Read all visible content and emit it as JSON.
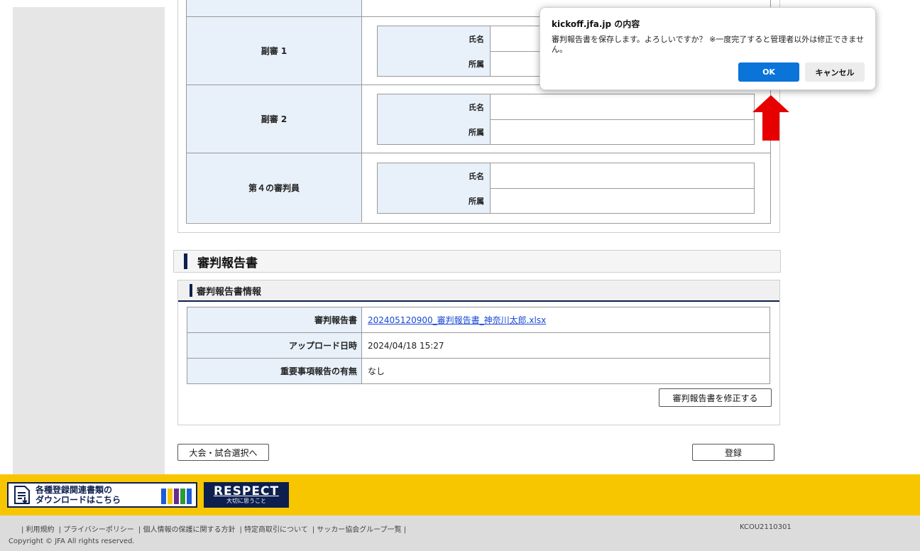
{
  "referees": [
    {
      "role": "副審 1",
      "name_label": "氏名",
      "org_label": "所属",
      "name": "",
      "org": ""
    },
    {
      "role": "副審 2",
      "name_label": "氏名",
      "org_label": "所属",
      "name": "",
      "org": ""
    },
    {
      "role": "第４の審判員",
      "name_label": "氏名",
      "org_label": "所属",
      "name": "",
      "org": ""
    }
  ],
  "report_section": {
    "title": "審判報告書",
    "sub_title": "審判報告書情報",
    "rows": [
      {
        "label": "審判報告書",
        "value": "202405120900_審判報告書_神奈川太郎.xlsx",
        "is_link": true
      },
      {
        "label": "アップロード日時",
        "value": "2024/04/18 15:27"
      },
      {
        "label": "重要事項報告の有無",
        "value": "なし"
      }
    ],
    "modify_button": "審判報告書を修正する"
  },
  "actions": {
    "back_button": "大会・試合選択へ",
    "register_button": "登録"
  },
  "footer": {
    "download_banner": {
      "line1": "各種登録関連書類の",
      "line2": "ダウンロードはこちら"
    },
    "respect_banner": {
      "big": "RESPECT",
      "small": "大切に思うこと"
    },
    "links": [
      "| 利用規約",
      "| プライバシーポリシー",
      "| 個人情報の保護に関する方針",
      "| 特定商取引について",
      "| サッカー協会グループ一覧 |"
    ],
    "screen_code": "KCOU2110301",
    "copyright": "Copyright © JFA All rights reserved."
  },
  "dialog": {
    "title": "kickoff.jfa.jp の内容",
    "message": "審判報告書を保存します。よろしいですか？ ※一度完了すると管理者以外は修正できません。",
    "ok_label": "OK",
    "cancel_label": "キャンセル"
  },
  "colors": {
    "accent_blue": "#0b74d9",
    "navy": "#0c1f4e",
    "footer_yellow": "#f7c600",
    "arrow_red": "#e60000"
  }
}
